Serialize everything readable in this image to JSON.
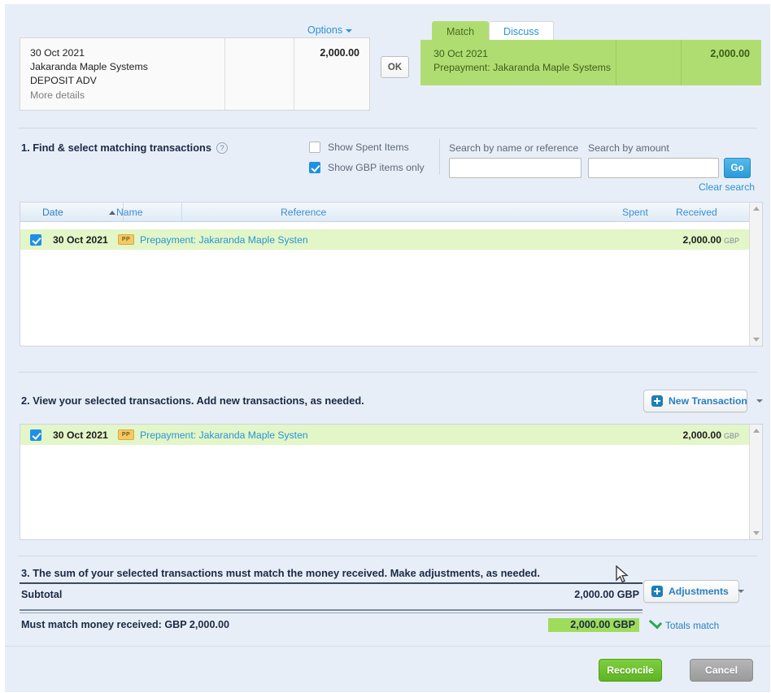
{
  "statement": {
    "options_label": "Options",
    "date": "30 Oct 2021",
    "payee": "Jakaranda Maple Systems",
    "description": "DEPOSIT ADV",
    "more_details": "More details",
    "amount": "2,000.00",
    "ok_label": "OK"
  },
  "tabs": [
    {
      "label": "Match",
      "active": true
    },
    {
      "label": "Discuss",
      "active": false
    }
  ],
  "match_panel": {
    "date": "30 Oct 2021",
    "name": "Prepayment: Jakaranda Maple Systems",
    "amount": "2,000.00"
  },
  "section1": {
    "title": "1. Find & select matching transactions",
    "help_icon": "question-mark-icon",
    "checkboxes": [
      {
        "label": "Show Spent Items",
        "checked": false
      },
      {
        "label": "Show GBP items only",
        "checked": true
      }
    ],
    "search_name_label": "Search by name or reference",
    "search_name_value": "",
    "search_amount_label": "Search by amount",
    "search_amount_value": "",
    "go_label": "Go",
    "clear_label": "Clear search",
    "columns": {
      "date": "Date",
      "name": "Name",
      "reference": "Reference",
      "spent": "Spent",
      "received": "Received"
    },
    "sort_column": "Date",
    "sort_direction": "ascending",
    "rows": [
      {
        "checked": true,
        "date": "30 Oct 2021",
        "badge": "PP",
        "name": "Prepayment: Jakaranda Maple Systen",
        "reference": "",
        "spent": "",
        "received": "2,000.00",
        "currency": "GBP"
      }
    ]
  },
  "section2": {
    "title": "2. View your selected transactions. Add new transactions, as needed.",
    "new_transaction_label": "New Transaction",
    "rows": [
      {
        "checked": true,
        "date": "30 Oct 2021",
        "badge": "PP",
        "name": "Prepayment: Jakaranda Maple Systen",
        "amount": "2,000.00",
        "currency": "GBP"
      }
    ]
  },
  "section3": {
    "title": "3. The sum of your selected transactions must match the money received. Make adjustments, as needed.",
    "adjustments_label": "Adjustments",
    "subtotal_label": "Subtotal",
    "subtotal_value": "2,000.00 GBP",
    "must_match_label": "Must match money received: GBP 2,000.00",
    "must_match_value": "2,000.00 GBP",
    "totals_match_label": "Totals match"
  },
  "footer": {
    "reconcile_label": "Reconcile",
    "cancel_label": "Cancel"
  },
  "colors": {
    "page_bg": "#e8eef8",
    "match_green": "#b0dd72",
    "row_green": "#e3f6c8",
    "link_blue": "#2a94d6",
    "accent_blue": "#1e90e5",
    "reconcile_green": "#5db522",
    "badge_orange": "#f3c968"
  }
}
